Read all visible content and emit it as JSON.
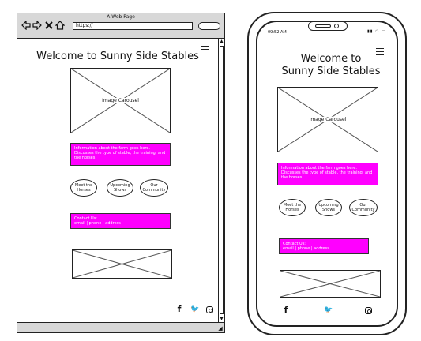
{
  "browser": {
    "window_title": "A Web Page",
    "url": "https://"
  },
  "page": {
    "title": "Welcome to Sunny Side Stables",
    "carousel_label": "Image Carousel",
    "info_text": "Information about the farm goes here. Discusses the type of stable, the training, and the horses",
    "buttons": [
      {
        "label": "Meet the Horses"
      },
      {
        "label": "Upcoming Shows"
      },
      {
        "label": "Our Community"
      }
    ],
    "contact_title": "Contact Us:",
    "contact_details": "email  |  phone |  address"
  },
  "phone": {
    "time": "09:52 AM",
    "title_line1": "Welcome to",
    "title_line2": "Sunny Side Stables"
  },
  "social": [
    {
      "name": "facebook-icon",
      "glyph": "f"
    },
    {
      "name": "twitter-icon",
      "glyph": "🐦"
    },
    {
      "name": "instagram-icon",
      "glyph": ""
    }
  ],
  "colors": {
    "accent": "#ff00ff",
    "chrome": "#d8d8d8"
  }
}
